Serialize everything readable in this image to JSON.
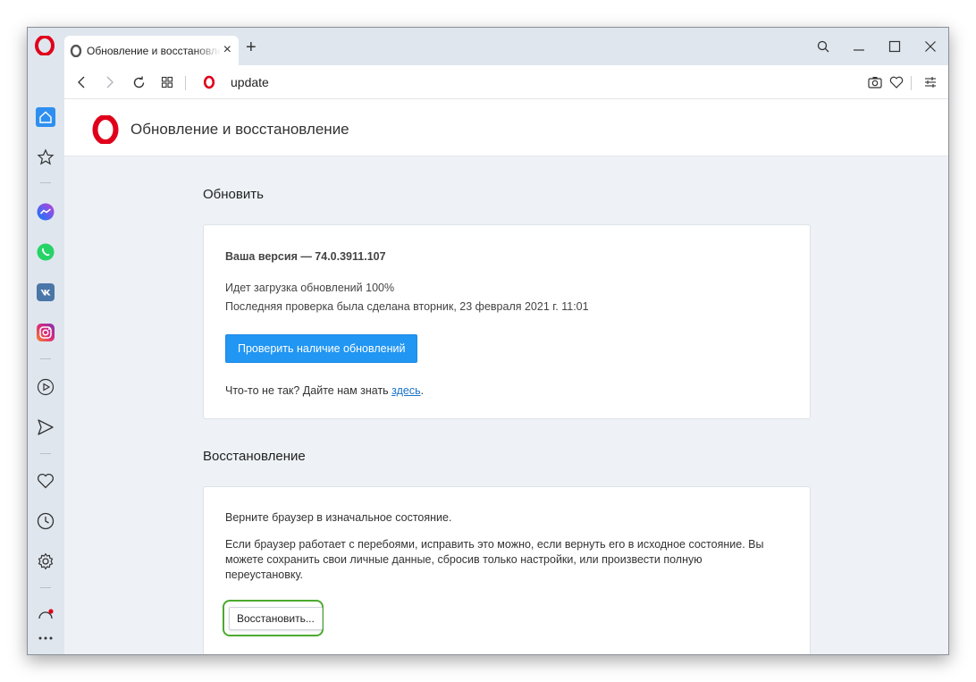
{
  "tab": {
    "title": "Обновление и восстановление",
    "close": "×"
  },
  "newtab": "+",
  "address": {
    "url": "update"
  },
  "page": {
    "title": "Обновление и восстановление"
  },
  "update": {
    "section_title": "Обновить",
    "version": "Ваша версия — 74.0.3911.107",
    "status": "Идет загрузка обновлений 100%",
    "last_check": "Последняя проверка была сделана вторник, 23 февраля 2021 г. 11:01",
    "check_button": "Проверить наличие обновлений",
    "feedback_prefix": "Что-то не так? Дайте нам знать ",
    "feedback_link": "здесь",
    "feedback_suffix": "."
  },
  "recovery": {
    "section_title": "Восстановление",
    "intro": "Верните браузер в изначальное состояние.",
    "description": "Если браузер работает с перебоями, исправить это можно, если вернуть его в исходное состояние. Вы можете сохранить свои личные данные, сбросив только настройки, или произвести полную переустановку.",
    "restore_button": "Восстановить..."
  },
  "sidebar_icons": [
    "home-icon",
    "bookmarks-icon",
    "messenger-icon",
    "whatsapp-icon",
    "vk-icon",
    "instagram-icon",
    "player-icon",
    "send-icon",
    "heart-icon",
    "history-icon",
    "settings-icon",
    "more-icon"
  ],
  "colors": {
    "accent": "#2196f3",
    "opera_red": "#e0001b",
    "highlight_green": "#4caa2f",
    "sidebar_active": "#2f8ff0"
  }
}
